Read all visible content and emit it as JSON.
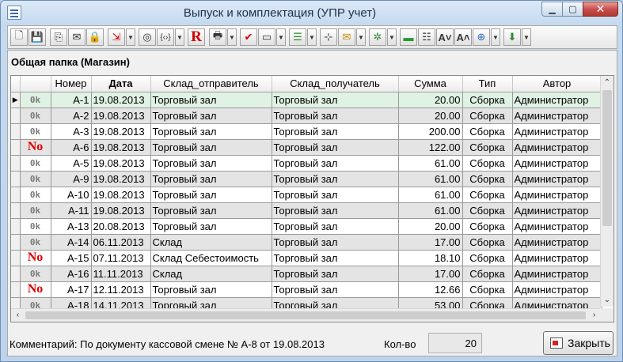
{
  "window": {
    "title": "Выпуск и комплектация (УПР учет)"
  },
  "folder_title": "Общая папка (Магазин)",
  "columns": [
    "",
    "",
    "Номер",
    "Дата",
    "Склад_отправитель",
    "Склад_получатель",
    "Сумма",
    "Тип",
    "Автор"
  ],
  "rows": [
    {
      "st": "Ok",
      "num": "А-1",
      "date": "19.08.2013",
      "from": "Торговый зал",
      "to": "Торговый зал",
      "sum": "20.00",
      "type": "Сборка",
      "author": "Администратор"
    },
    {
      "st": "Ok",
      "num": "А-2",
      "date": "19.08.2013",
      "from": "Торговый зал",
      "to": "Торговый зал",
      "sum": "20.00",
      "type": "Сборка",
      "author": "Администратор"
    },
    {
      "st": "Ok",
      "num": "А-3",
      "date": "19.08.2013",
      "from": "Торговый зал",
      "to": "Торговый зал",
      "sum": "200.00",
      "type": "Сборка",
      "author": "Администратор"
    },
    {
      "st": "No",
      "num": "А-6",
      "date": "19.08.2013",
      "from": "Торговый зал",
      "to": "Торговый зал",
      "sum": "122.00",
      "type": "Сборка",
      "author": "Администратор"
    },
    {
      "st": "Ok",
      "num": "А-5",
      "date": "19.08.2013",
      "from": "Торговый зал",
      "to": "Торговый зал",
      "sum": "61.00",
      "type": "Сборка",
      "author": "Администратор"
    },
    {
      "st": "Ok",
      "num": "А-9",
      "date": "19.08.2013",
      "from": "Торговый зал",
      "to": "Торговый зал",
      "sum": "61.00",
      "type": "Сборка",
      "author": "Администратор"
    },
    {
      "st": "Ok",
      "num": "А-10",
      "date": "19.08.2013",
      "from": "Торговый зал",
      "to": "Торговый зал",
      "sum": "61.00",
      "type": "Сборка",
      "author": "Администратор"
    },
    {
      "st": "Ok",
      "num": "А-11",
      "date": "19.08.2013",
      "from": "Торговый зал",
      "to": "Торговый зал",
      "sum": "61.00",
      "type": "Сборка",
      "author": "Администратор"
    },
    {
      "st": "Ok",
      "num": "А-13",
      "date": "20.08.2013",
      "from": "Торговый зал",
      "to": "Торговый зал",
      "sum": "20.00",
      "type": "Сборка",
      "author": "Администратор"
    },
    {
      "st": "Ok",
      "num": "А-14",
      "date": "06.11.2013",
      "from": "Склад",
      "to": "Торговый зал",
      "sum": "17.00",
      "type": "Сборка",
      "author": "Администратор"
    },
    {
      "st": "No",
      "num": "А-15",
      "date": "07.11.2013",
      "from": "Склад Себестоимость",
      "to": "Торговый зал",
      "sum": "18.10",
      "type": "Сборка",
      "author": "Администратор"
    },
    {
      "st": "Ok",
      "num": "А-16",
      "date": "11.11.2013",
      "from": "Склад",
      "to": "Торговый зал",
      "sum": "17.00",
      "type": "Сборка",
      "author": "Администратор"
    },
    {
      "st": "No",
      "num": "А-17",
      "date": "12.11.2013",
      "from": "Торговый зал",
      "to": "Торговый зал",
      "sum": "12.66",
      "type": "Сборка",
      "author": "Администратор"
    },
    {
      "st": "Ok",
      "num": "А-18",
      "date": "14.11.2013",
      "from": "Торговый зал",
      "to": "Торговый зал",
      "sum": "53.00",
      "type": "Сборка",
      "author": "Администратор"
    }
  ],
  "status_ok_label": "0k",
  "status_no_label": "No",
  "comment": "Комментарий: По документу кассовой смене № А-8 от 19.08.2013",
  "count_label": "Кол-во",
  "count_value": "20",
  "close_label": "Закрыть",
  "toolbar_buttons": [
    "new-doc-icon",
    "save-icon",
    "copy-icon",
    "mail-icon",
    "lock-icon",
    "import-icon",
    "binoculars-icon",
    "brackets-icon",
    "r-icon",
    "print-icon",
    "check-icon",
    "card-icon",
    "list-color-icon",
    "tree-icon",
    "envelope-icon",
    "gear-icon",
    "folder-icon",
    "columns-icon",
    "font-down-icon",
    "font-up-icon",
    "network-icon",
    "download-icon"
  ],
  "colors": {
    "selected_row": "#dff2e3",
    "alt_row": "#e4e4e4",
    "no_status": "#e00000",
    "ok_status": "#7a7a7a"
  }
}
